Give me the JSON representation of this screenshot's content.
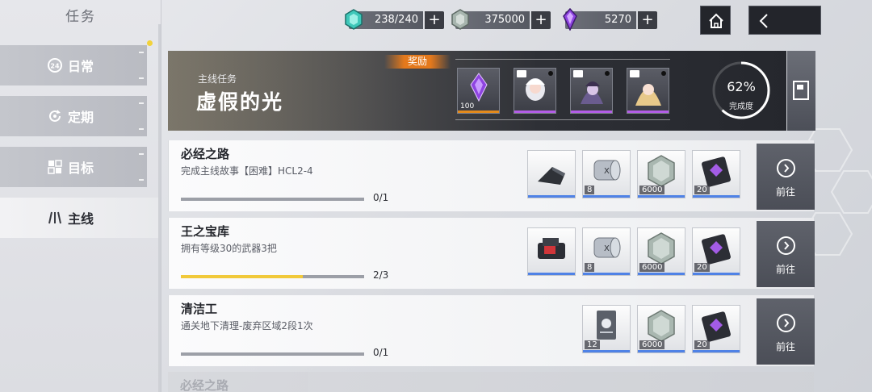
{
  "sidebar": {
    "title": "任务",
    "items": [
      {
        "label": "日常",
        "icon": "daily-24-icon",
        "active": false
      },
      {
        "label": "定期",
        "icon": "cycle-icon",
        "active": false
      },
      {
        "label": "目标",
        "icon": "target-icon",
        "active": false
      },
      {
        "label": "主线",
        "icon": "mainline-icon",
        "active": true
      }
    ]
  },
  "currencies": [
    {
      "icon": "stamina-crystal-icon",
      "value": "238/240"
    },
    {
      "icon": "hex-coin-icon",
      "value": "375000"
    },
    {
      "icon": "purple-crystal-icon",
      "value": "5270"
    }
  ],
  "header": {
    "home_icon": "home-icon",
    "back_icon": "back-arrow-icon"
  },
  "banner": {
    "subtitle": "主线任务",
    "title": "虚假的光",
    "reward_label": "奖励",
    "rewards": [
      {
        "icon": "purple-crystal-icon",
        "qty": "100",
        "rarity": "orange"
      },
      {
        "icon": "character-card-icon",
        "qty": "",
        "rarity": "purple"
      },
      {
        "icon": "character-card-icon",
        "qty": "",
        "rarity": "purple"
      },
      {
        "icon": "character-card-icon",
        "qty": "",
        "rarity": "purple"
      }
    ],
    "progress_percent": "62%",
    "progress_value": 0.62,
    "progress_label": "完成度"
  },
  "tasks": [
    {
      "title": "必经之路",
      "desc": "完成主线故事【困难】HCL2-4",
      "progress": 0,
      "count": "0/1",
      "rewards": [
        {
          "icon": "weapon-part-icon",
          "qty": ""
        },
        {
          "icon": "tape-roll-icon",
          "qty": "8"
        },
        {
          "icon": "hex-coin-icon",
          "qty": "6000"
        },
        {
          "icon": "purple-chip-icon",
          "qty": "20"
        }
      ],
      "go_label": "前往"
    },
    {
      "title": "王之宝库",
      "desc": "拥有等级30的武器3把",
      "progress": 0.667,
      "count": "2/3",
      "rewards": [
        {
          "icon": "red-dot-sight-icon",
          "qty": ""
        },
        {
          "icon": "tape-roll-icon",
          "qty": "8"
        },
        {
          "icon": "hex-coin-icon",
          "qty": "6000"
        },
        {
          "icon": "purple-chip-icon",
          "qty": "20"
        }
      ],
      "go_label": "前往"
    },
    {
      "title": "清洁工",
      "desc": "通关地下清理-废弃区域2段1次",
      "progress": 0,
      "count": "0/1",
      "rewards": [
        {
          "icon": "ticket-card-icon",
          "qty": "12"
        },
        {
          "icon": "hex-coin-icon",
          "qty": "6000"
        },
        {
          "icon": "purple-chip-icon",
          "qty": "20"
        }
      ],
      "go_label": "前往"
    }
  ],
  "partial_task_title": "必经之路",
  "colors": {
    "progress_yellow": "#f1c93a",
    "reward_orange": "#e4791c",
    "rarity_purple": "#a35ce6",
    "rarity_blue": "#4f82e6",
    "go_button": "#565962"
  }
}
